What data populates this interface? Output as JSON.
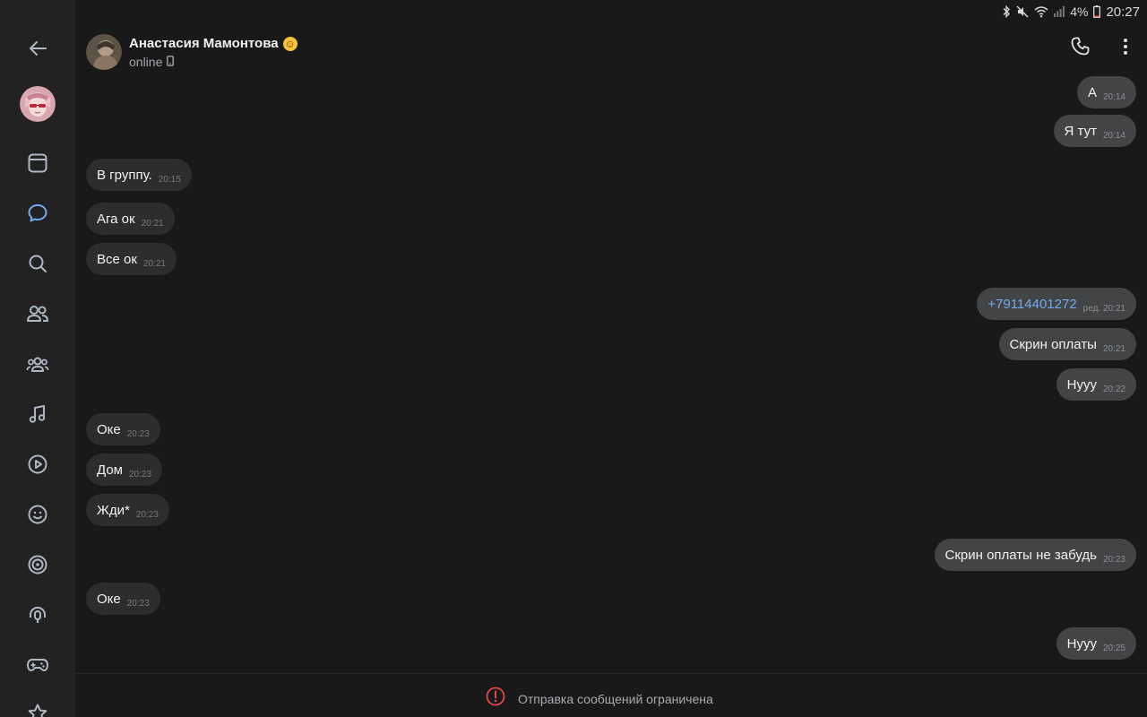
{
  "status_bar": {
    "battery": "4%",
    "time": "20:27"
  },
  "sidebar": {
    "items": [
      {
        "icon": "back-arrow-icon"
      },
      {
        "icon": "user-avatar"
      },
      {
        "icon": "news-feed-icon"
      },
      {
        "icon": "messages-icon",
        "active": true
      },
      {
        "icon": "search-icon"
      },
      {
        "icon": "friends-icon"
      },
      {
        "icon": "communities-icon"
      },
      {
        "icon": "music-icon"
      },
      {
        "icon": "video-icon"
      },
      {
        "icon": "stickers-icon"
      },
      {
        "icon": "live-icon"
      },
      {
        "icon": "podcasts-icon"
      },
      {
        "icon": "games-icon"
      },
      {
        "icon": "bookmarks-icon"
      }
    ]
  },
  "header": {
    "name": "Анастасия Мамонтова",
    "emoji": "☺",
    "status": "online",
    "status_device": "mobile-icon"
  },
  "messages": [
    {
      "dir": "out",
      "text": "А",
      "time": "20:14"
    },
    {
      "dir": "out",
      "text": "Я тут",
      "time": "20:14"
    },
    {
      "dir": "in",
      "text": "В группу.",
      "time": "20:15"
    },
    {
      "dir": "in",
      "text": "Ага ок",
      "time": "20:21"
    },
    {
      "dir": "in",
      "text": "Все ок",
      "time": "20:21"
    },
    {
      "dir": "out",
      "text": "+79114401272",
      "time": "ред. 20:21",
      "link": true
    },
    {
      "dir": "out",
      "text": "Скрин оплаты",
      "time": "20:21"
    },
    {
      "dir": "out",
      "text": "Нууу",
      "time": "20:22"
    },
    {
      "dir": "in",
      "text": "Оке",
      "time": "20:23"
    },
    {
      "dir": "in",
      "text": "Дом",
      "time": "20:23"
    },
    {
      "dir": "in",
      "text": "Жди*",
      "time": "20:23"
    },
    {
      "dir": "out",
      "text": "Скрин оплаты не забудь",
      "time": "20:23"
    },
    {
      "dir": "in",
      "text": "Оке",
      "time": "20:23"
    },
    {
      "dir": "out",
      "text": "Нууу",
      "time": "20:25"
    }
  ],
  "footer": {
    "text": "Отправка сообщений ограничена"
  },
  "colors": {
    "accent": "#71aaeb",
    "background": "#19191a",
    "sidebar": "#222223",
    "warning": "#e64646"
  }
}
